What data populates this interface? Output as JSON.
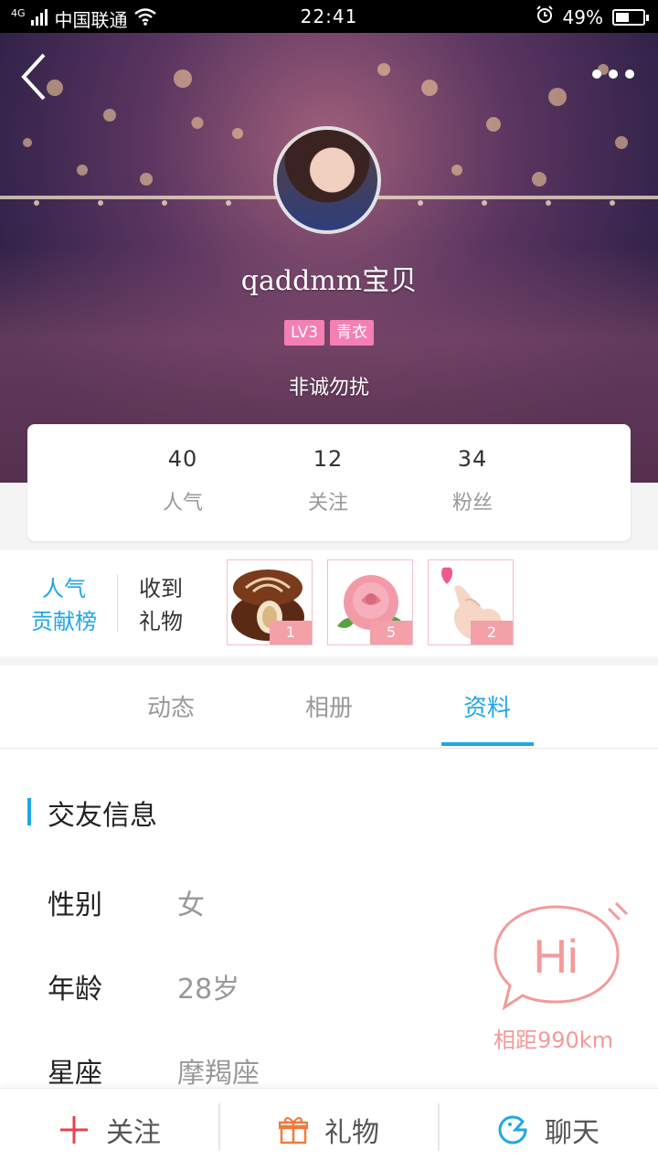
{
  "status_bar": {
    "network": "4G",
    "carrier": "中国联通",
    "time": "22:41",
    "battery_percent": "49%",
    "battery_level": 0.49
  },
  "profile": {
    "username": "qaddmm宝贝",
    "badges": [
      "LV3",
      "青衣"
    ],
    "signature": "非诚勿扰"
  },
  "stats": [
    {
      "value": "40",
      "label": "人气"
    },
    {
      "value": "12",
      "label": "关注"
    },
    {
      "value": "34",
      "label": "粉丝"
    }
  ],
  "gift_row": {
    "rank_line1": "人气",
    "rank_line2": "贡献榜",
    "gifts_line1": "收到",
    "gifts_line2": "礼物",
    "gifts": [
      {
        "icon": "chocolate-icon",
        "count": "1"
      },
      {
        "icon": "rose-icon",
        "count": "5"
      },
      {
        "icon": "finger-heart-icon",
        "count": "2"
      }
    ]
  },
  "tabs": [
    {
      "label": "动态",
      "active": false
    },
    {
      "label": "相册",
      "active": false
    },
    {
      "label": "资料",
      "active": true
    }
  ],
  "info": {
    "section_title": "交友信息",
    "rows": [
      {
        "label": "性别",
        "value": "女"
      },
      {
        "label": "年龄",
        "value": "28岁"
      },
      {
        "label": "星座",
        "value": "摩羯座"
      }
    ]
  },
  "hi": {
    "text": "Hi",
    "distance": "相距990km"
  },
  "bottom_bar": {
    "follow": "关注",
    "gift": "礼物",
    "chat": "聊天"
  },
  "colors": {
    "accent": "#1fa7e6",
    "badge_pink": "#f57fb3",
    "hi_pink": "#f39a9a",
    "follow_red": "#e8434a",
    "gift_orange": "#f07a3a"
  }
}
